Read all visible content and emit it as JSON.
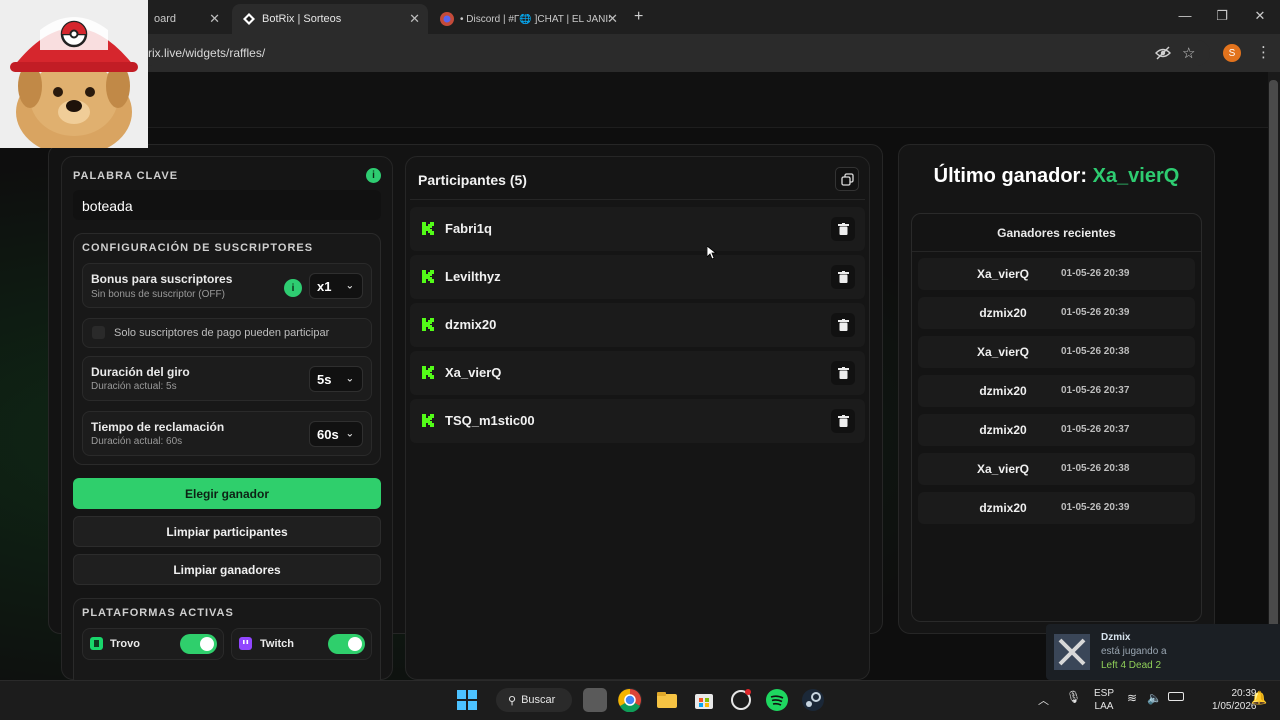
{
  "browser": {
    "tabs": [
      {
        "label": "oard",
        "active": false
      },
      {
        "label": "BotRix | Sorteos",
        "active": true
      },
      {
        "label": "• Discord | #Γ🌐 ]CHAT | EL JANISI",
        "active": false
      }
    ],
    "new_tab_symbol": "+",
    "url": "rix.live/widgets/raffles/",
    "profile_initial": "S",
    "icons": [
      "eye-off-icon",
      "star-icon",
      "menu-dots-icon"
    ]
  },
  "config": {
    "keyword_label": "PALABRA CLAVE",
    "keyword_value": "boteada",
    "subs_section_label": "CONFIGURACIÓN DE SUSCRIPTORES",
    "bonus_title": "Bonus para suscriptores",
    "bonus_sub": "Sin bonus de suscriptor (OFF)",
    "bonus_value": "x1",
    "only_paid_label": "Solo suscriptores de pago pueden participar",
    "spin_title": "Duración del giro",
    "spin_sub": "Duración actual: 5s",
    "spin_value": "5s",
    "claim_title": "Tiempo de reclamación",
    "claim_sub": "Duración actual: 60s",
    "claim_value": "60s",
    "btn_pick": "Elegir ganador",
    "btn_clear_participants": "Limpiar participantes",
    "btn_clear_winners": "Limpiar ganadores",
    "platforms_label": "PLATAFORMAS ACTIVAS",
    "platforms": [
      {
        "name": "Trovo",
        "enabled": true
      },
      {
        "name": "Twitch",
        "enabled": true
      }
    ],
    "info_symbol": "i"
  },
  "participants": {
    "title": "Participantes (5)",
    "items": [
      "Fabri1q",
      "Levilthyz",
      "dzmix20",
      "Xa_vierQ",
      "TSQ_m1stic00"
    ]
  },
  "winners": {
    "last_label": "Último ganador:",
    "last_name": "Xa_vierQ",
    "recent_title": "Ganadores recientes",
    "items": [
      {
        "name": "Xa_vierQ",
        "date": "01-05-26 20:39"
      },
      {
        "name": "dzmix20",
        "date": "01-05-26 20:39"
      },
      {
        "name": "Xa_vierQ",
        "date": "01-05-26 20:38"
      },
      {
        "name": "dzmix20",
        "date": "01-05-26 20:37"
      },
      {
        "name": "dzmix20",
        "date": "01-05-26 20:37"
      },
      {
        "name": "Xa_vierQ",
        "date": "01-05-26 20:38"
      },
      {
        "name": "dzmix20",
        "date": "01-05-26 20:39"
      }
    ]
  },
  "notification": {
    "user": "Dzmix",
    "line1": "está jugando a",
    "game": "Left 4 Dead 2"
  },
  "taskbar": {
    "search_label": "Buscar",
    "lang_top": "ESP",
    "lang_bottom": "LAA",
    "time": "20:39",
    "date": "1/05/2026"
  },
  "colors": {
    "accent_green": "#2fcf6c",
    "winner_green": "#2ecc71",
    "kick_green": "#53fc18"
  }
}
